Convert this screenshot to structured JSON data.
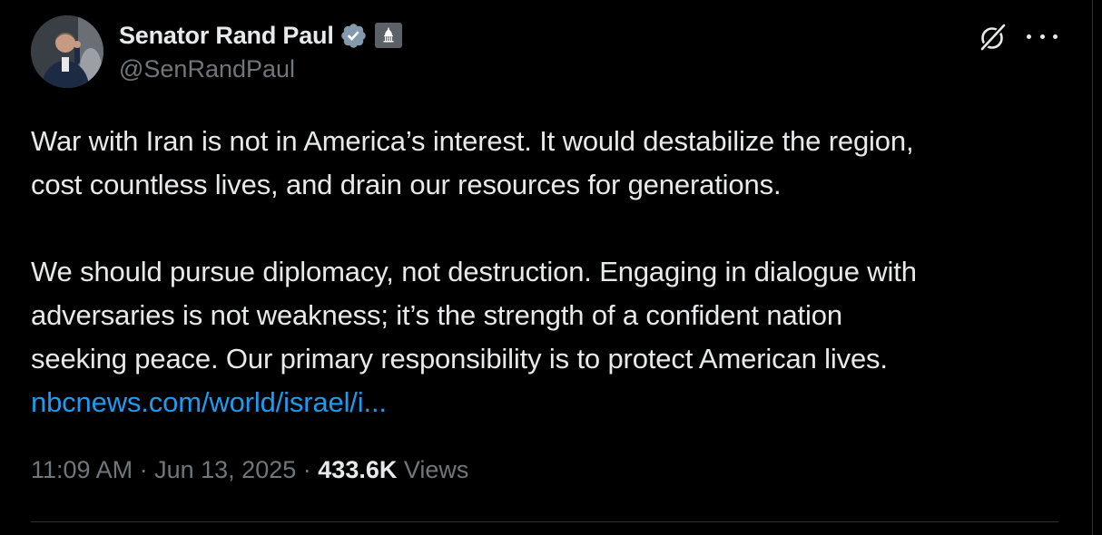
{
  "author": {
    "display_name": "Senator Rand Paul",
    "handle": "@SenRandPaul",
    "verified_icon": "verified-badge-icon",
    "affiliation_icon": "government-building-icon"
  },
  "post": {
    "paragraphs": [
      [
        "War with Iran is not in America’s interest. It would destabilize the region,",
        "cost countless lives, and drain our resources for generations."
      ],
      [
        "We should pursue diplomacy, not destruction. Engaging in dialogue with",
        "adversaries is not weakness; it’s the strength of a confident nation",
        "seeking peace. Our primary responsibility is to protect American lives."
      ]
    ],
    "link_text": "nbcnews.com/world/israel/i..."
  },
  "meta": {
    "time": "11:09 AM",
    "separator": "·",
    "date": "Jun 13, 2025",
    "views_count": "433.6K",
    "views_label": "Views"
  },
  "colors": {
    "background": "#000000",
    "text": "#e7e9ea",
    "muted": "#71767b",
    "link": "#1d9bf0",
    "verified": "#829aab"
  }
}
